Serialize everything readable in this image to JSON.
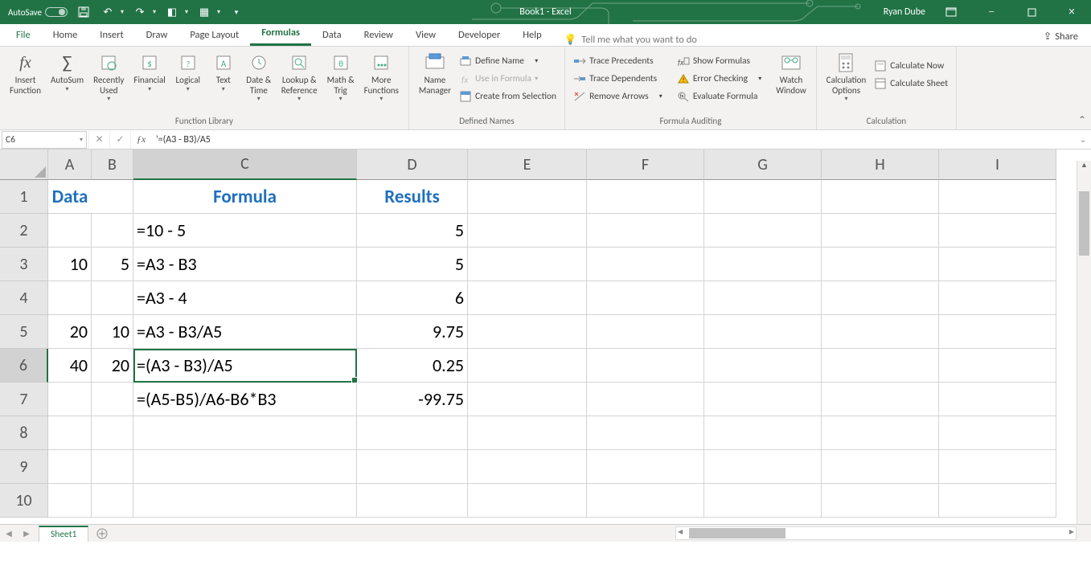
{
  "titlebar": {
    "autosave_label": "AutoSave",
    "title": "Book1  -  Excel",
    "user": "Ryan Dube"
  },
  "menu": {
    "tabs": [
      "File",
      "Home",
      "Insert",
      "Draw",
      "Page Layout",
      "Formulas",
      "Data",
      "Review",
      "View",
      "Developer",
      "Help"
    ],
    "active_index": 5,
    "tell": "Tell me what you want to do",
    "share": "Share"
  },
  "ribbon": {
    "groups": {
      "fnlib": {
        "label": "Function Library",
        "btns": [
          "Insert\nFunction",
          "AutoSum",
          "Recently\nUsed",
          "Financial",
          "Logical",
          "Text",
          "Date &\nTime",
          "Lookup &\nReference",
          "Math &\nTrig",
          "More\nFunctions"
        ]
      },
      "defnames": {
        "label": "Defined Names",
        "big": "Name\nManager",
        "items": [
          "Define Name",
          "Use in Formula",
          "Create from Selection"
        ]
      },
      "audit": {
        "label": "Formula Auditing",
        "left": [
          "Trace Precedents",
          "Trace Dependents",
          "Remove Arrows"
        ],
        "right": [
          "Show Formulas",
          "Error Checking",
          "Evaluate Formula"
        ],
        "watch": "Watch\nWindow"
      },
      "calc": {
        "label": "Calculation",
        "big": "Calculation\nOptions",
        "items": [
          "Calculate Now",
          "Calculate Sheet"
        ]
      }
    }
  },
  "formula_bar": {
    "name_box": "C6",
    "formula": "'=(A3 - B3)/A5"
  },
  "sheet": {
    "columns": [
      "A",
      "B",
      "C",
      "D",
      "E",
      "F",
      "G",
      "H",
      "I"
    ],
    "rows": [
      "1",
      "2",
      "3",
      "4",
      "5",
      "6",
      "7",
      "8",
      "9",
      "10"
    ],
    "selected": {
      "col": "C",
      "row": "6"
    },
    "tab": "Sheet1",
    "data": {
      "headers": {
        "A1": "Data",
        "C1": "Formula",
        "D1": "Results"
      },
      "cells": {
        "A3": "10",
        "B3": "5",
        "A5": "20",
        "B5": "10",
        "A6": "40",
        "B6": "20",
        "C2": "=10 - 5",
        "C3": "=A3 - B3",
        "C4": "=A3 - 4",
        "C5": "=A3 - B3/A5",
        "C6": "=(A3 - B3)/A5",
        "C7": "=(A5-B5)/A6-B6*B3",
        "D2": "5",
        "D3": "5",
        "D4": "6",
        "D5": "9.75",
        "D6": "0.25",
        "D7": "-99.75"
      }
    }
  }
}
